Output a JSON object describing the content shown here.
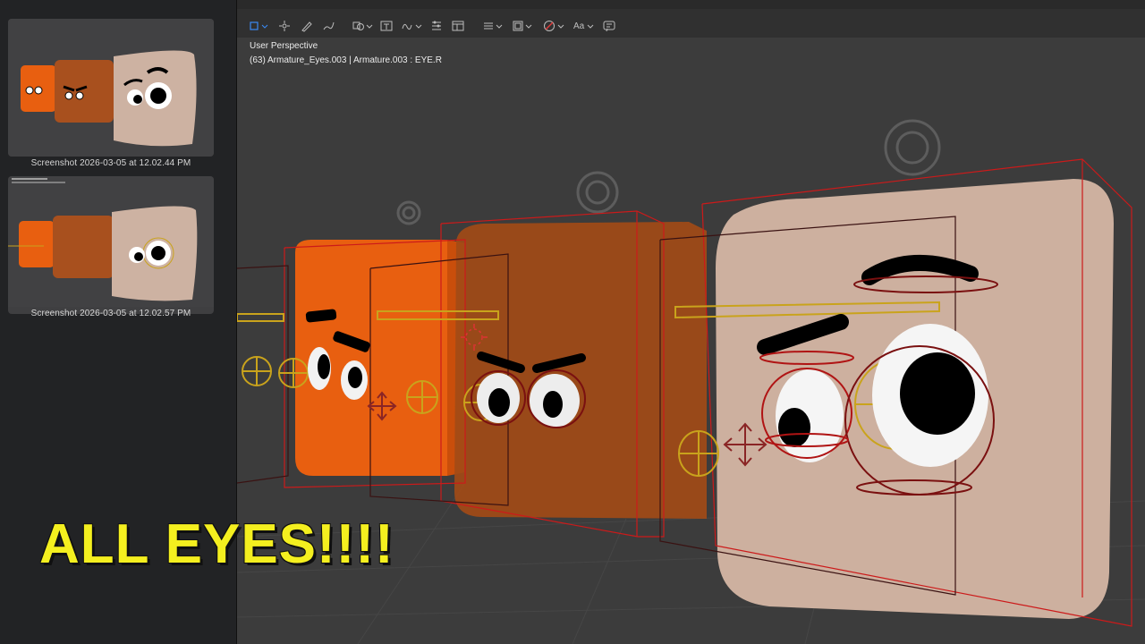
{
  "sidebar": {
    "thumbnails": [
      {
        "caption": "Screenshot 2026-03-05 at 12.02.44 PM"
      },
      {
        "caption": "Screenshot 2026-03-05 at 12.02.57 PM"
      }
    ]
  },
  "toolbar": {
    "items": [
      {
        "icon": "select-box-icon"
      },
      {
        "icon": "cursor-sparkle-icon"
      },
      {
        "icon": "annotate-pen-icon"
      },
      {
        "icon": "sketch-pen-icon"
      },
      {
        "icon": "shapes-icon"
      },
      {
        "icon": "text-box-icon"
      },
      {
        "icon": "signature-icon"
      },
      {
        "icon": "adjust-color-icon"
      },
      {
        "icon": "page-layout-icon"
      },
      {
        "icon": "line-style-icon"
      },
      {
        "icon": "border-color-icon"
      },
      {
        "icon": "fill-color-icon"
      },
      {
        "icon": "text-style-icon",
        "label": "Aa"
      },
      {
        "icon": "description-icon"
      }
    ]
  },
  "viewport": {
    "mode_label": "User Perspective",
    "object_label": "(63) Armature_Eyes.003 | Armature.003 : EYE.R"
  },
  "caption": {
    "text": "ALL EYES!!!!"
  },
  "colors": {
    "accent_blue": "#3a8bf5",
    "caption_yellow": "#f4ef1f",
    "cube_orange": "#e85f10",
    "cube_brown": "#b3521c",
    "cube_beige": "#c9ab9a",
    "armature_gold": "#c9a31c",
    "bound_red": "#cc1a1a"
  }
}
